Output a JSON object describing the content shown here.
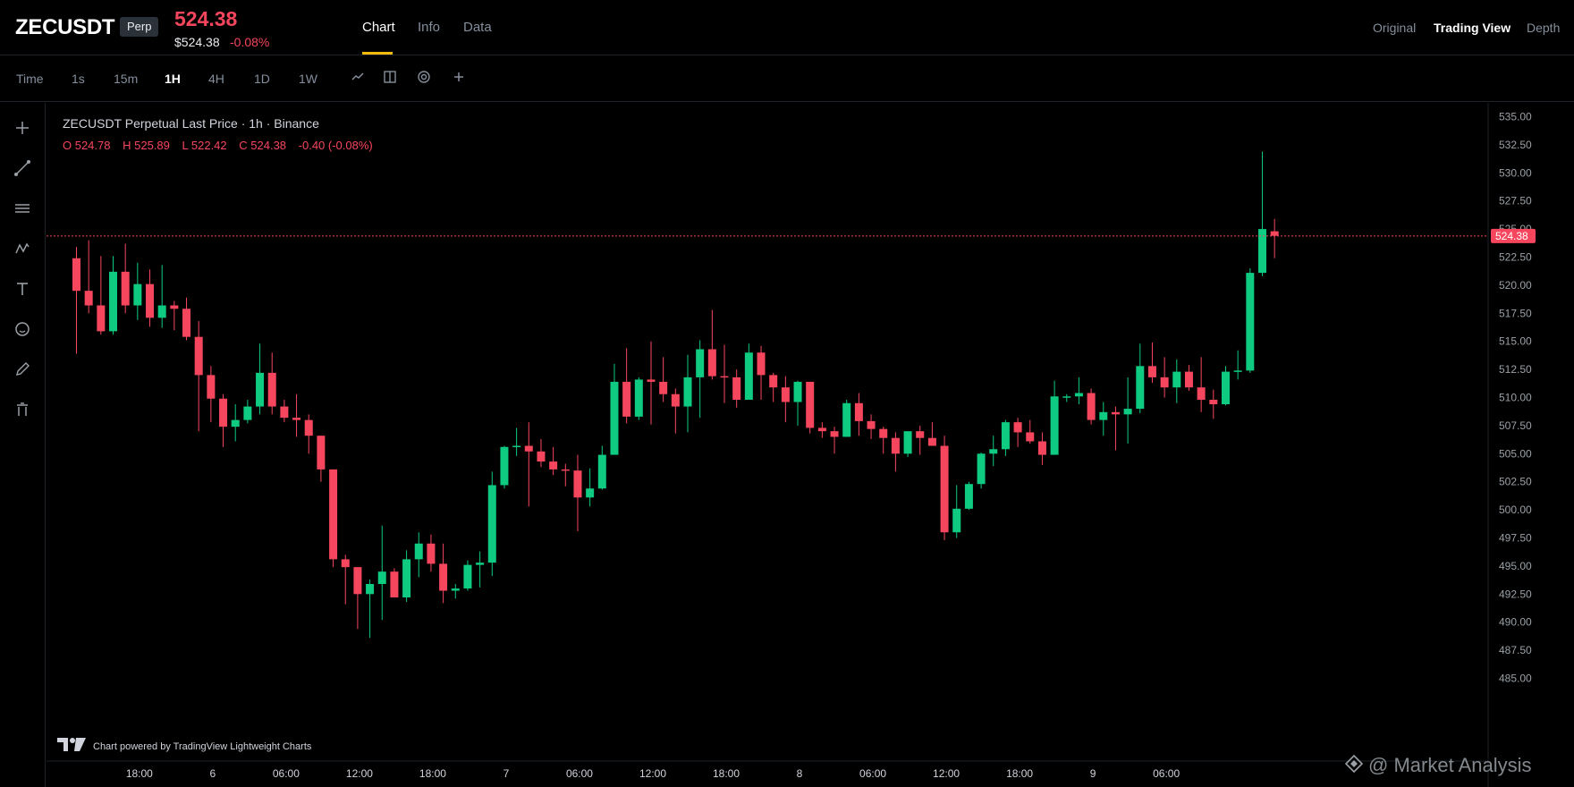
{
  "header": {
    "symbol": "ZECUSDT",
    "badge": "Perp",
    "last_price": "524.38",
    "sub_price": "$524.38",
    "sub_change": "-0.08%",
    "tabs": [
      {
        "label": "Chart",
        "active": true
      },
      {
        "label": "Info",
        "active": false
      },
      {
        "label": "Data",
        "active": false
      }
    ],
    "views": [
      {
        "label": "Original",
        "active": false
      },
      {
        "label": "Trading View",
        "active": true
      },
      {
        "label": "Depth",
        "active": false
      }
    ]
  },
  "toolbar": {
    "time_label": "Time",
    "intervals": [
      {
        "label": "1s",
        "active": false
      },
      {
        "label": "15m",
        "active": false
      },
      {
        "label": "1H",
        "active": true
      },
      {
        "label": "4H",
        "active": false
      },
      {
        "label": "1D",
        "active": false
      },
      {
        "label": "1W",
        "active": false
      }
    ],
    "icons": [
      "indicator-icon",
      "layout-icon",
      "settings-icon",
      "add-icon"
    ]
  },
  "left_tools": [
    "crosshair-icon",
    "trend-line-icon",
    "horizontal-lines-icon",
    "wave-icon",
    "text-icon",
    "emoji-icon",
    "pencil-icon",
    "trash-icon"
  ],
  "legend": {
    "title": "ZECUSDT Perpetual Last Price · 1h · Binance",
    "o": "O 524.78",
    "h": "H 525.89",
    "l": "L 522.42",
    "c": "C 524.38",
    "change": "-0.40 (-0.08%)"
  },
  "powered_by": "Chart powered by TradingView Lightweight Charts",
  "watermark": "@ Market Analysis",
  "colors": {
    "up": "#0ecb81",
    "down": "#f6465d",
    "accent": "#f0b90b",
    "background": "#000000"
  },
  "chart_data": {
    "type": "candlestick",
    "title": "ZECUSDT Perpetual Last Price · 1h · Binance",
    "last_price": 524.38,
    "last_price_label": "524.38",
    "ylim": [
      484,
      536
    ],
    "y_ticks": [
      "535.00",
      "532.50",
      "530.00",
      "527.50",
      "525.00",
      "522.50",
      "520.00",
      "517.50",
      "515.00",
      "512.50",
      "510.00",
      "507.50",
      "505.00",
      "502.50",
      "500.00",
      "497.50",
      "495.00",
      "492.50",
      "490.00",
      "487.50",
      "485.00"
    ],
    "x_ticks": [
      {
        "label": "18:00",
        "bar": 5
      },
      {
        "label": "6",
        "bar": 11
      },
      {
        "label": "06:00",
        "bar": 17
      },
      {
        "label": "12:00",
        "bar": 23
      },
      {
        "label": "18:00",
        "bar": 29
      },
      {
        "label": "7",
        "bar": 35
      },
      {
        "label": "06:00",
        "bar": 41
      },
      {
        "label": "12:00",
        "bar": 47
      },
      {
        "label": "18:00",
        "bar": 53
      },
      {
        "label": "8",
        "bar": 59
      },
      {
        "label": "06:00",
        "bar": 65
      },
      {
        "label": "12:00",
        "bar": 71
      },
      {
        "label": "18:00",
        "bar": 77
      },
      {
        "label": "9",
        "bar": 83
      },
      {
        "label": "06:00",
        "bar": 89
      }
    ],
    "candles": [
      {
        "o": 522.4,
        "h": 523.4,
        "l": 513.9,
        "c": 519.5
      },
      {
        "o": 519.5,
        "h": 524.0,
        "l": 517.5,
        "c": 518.2
      },
      {
        "o": 518.2,
        "h": 522.6,
        "l": 515.6,
        "c": 515.9
      },
      {
        "o": 515.9,
        "h": 522.6,
        "l": 515.6,
        "c": 521.2
      },
      {
        "o": 521.2,
        "h": 523.7,
        "l": 517.5,
        "c": 518.2
      },
      {
        "o": 518.2,
        "h": 522.0,
        "l": 516.9,
        "c": 520.1
      },
      {
        "o": 520.1,
        "h": 521.4,
        "l": 516.3,
        "c": 517.1
      },
      {
        "o": 517.1,
        "h": 521.8,
        "l": 516.2,
        "c": 518.2
      },
      {
        "o": 518.2,
        "h": 518.6,
        "l": 516.0,
        "c": 517.9
      },
      {
        "o": 517.9,
        "h": 518.9,
        "l": 515.1,
        "c": 515.4
      },
      {
        "o": 515.4,
        "h": 516.8,
        "l": 507.0,
        "c": 512.0
      },
      {
        "o": 512.0,
        "h": 512.8,
        "l": 507.8,
        "c": 509.9
      },
      {
        "o": 509.9,
        "h": 510.3,
        "l": 505.6,
        "c": 507.4
      },
      {
        "o": 507.4,
        "h": 509.4,
        "l": 506.1,
        "c": 508.0
      },
      {
        "o": 508.0,
        "h": 509.8,
        "l": 507.7,
        "c": 509.2
      },
      {
        "o": 509.2,
        "h": 514.8,
        "l": 508.5,
        "c": 512.2
      },
      {
        "o": 512.2,
        "h": 514.0,
        "l": 508.5,
        "c": 509.2
      },
      {
        "o": 509.2,
        "h": 509.8,
        "l": 507.8,
        "c": 508.2
      },
      {
        "o": 508.2,
        "h": 510.3,
        "l": 506.5,
        "c": 508.0
      },
      {
        "o": 508.0,
        "h": 508.5,
        "l": 505.0,
        "c": 506.6
      },
      {
        "o": 506.6,
        "h": 506.6,
        "l": 502.5,
        "c": 503.6
      },
      {
        "o": 503.6,
        "h": 503.6,
        "l": 494.9,
        "c": 495.6
      },
      {
        "o": 495.6,
        "h": 496.0,
        "l": 491.6,
        "c": 494.9
      },
      {
        "o": 494.9,
        "h": 494.9,
        "l": 489.4,
        "c": 492.5
      },
      {
        "o": 492.5,
        "h": 493.8,
        "l": 488.6,
        "c": 493.4
      },
      {
        "o": 493.4,
        "h": 498.6,
        "l": 490.2,
        "c": 494.5
      },
      {
        "o": 494.5,
        "h": 494.8,
        "l": 492.2,
        "c": 492.2
      },
      {
        "o": 492.2,
        "h": 496.4,
        "l": 491.8,
        "c": 495.6
      },
      {
        "o": 495.6,
        "h": 498.0,
        "l": 494.0,
        "c": 497.0
      },
      {
        "o": 497.0,
        "h": 497.8,
        "l": 494.5,
        "c": 495.2
      },
      {
        "o": 495.2,
        "h": 497.0,
        "l": 491.7,
        "c": 492.8
      },
      {
        "o": 492.8,
        "h": 493.4,
        "l": 492.1,
        "c": 493.0
      },
      {
        "o": 493.0,
        "h": 495.5,
        "l": 492.8,
        "c": 495.1
      },
      {
        "o": 495.1,
        "h": 496.3,
        "l": 493.1,
        "c": 495.3
      },
      {
        "o": 495.3,
        "h": 503.4,
        "l": 494.1,
        "c": 502.2
      },
      {
        "o": 502.2,
        "h": 505.7,
        "l": 501.9,
        "c": 505.6
      },
      {
        "o": 505.6,
        "h": 507.3,
        "l": 504.8,
        "c": 505.7
      },
      {
        "o": 505.7,
        "h": 507.8,
        "l": 500.3,
        "c": 505.2
      },
      {
        "o": 505.2,
        "h": 506.3,
        "l": 503.8,
        "c": 504.3
      },
      {
        "o": 504.3,
        "h": 505.6,
        "l": 503.1,
        "c": 503.6
      },
      {
        "o": 503.6,
        "h": 504.1,
        "l": 502.1,
        "c": 503.5
      },
      {
        "o": 503.5,
        "h": 504.9,
        "l": 498.1,
        "c": 501.1
      },
      {
        "o": 501.1,
        "h": 503.7,
        "l": 500.3,
        "c": 501.9
      },
      {
        "o": 501.9,
        "h": 505.7,
        "l": 501.8,
        "c": 504.9
      },
      {
        "o": 504.9,
        "h": 513.0,
        "l": 504.9,
        "c": 511.4
      },
      {
        "o": 511.4,
        "h": 514.4,
        "l": 507.7,
        "c": 508.3
      },
      {
        "o": 508.3,
        "h": 511.8,
        "l": 508.0,
        "c": 511.6
      },
      {
        "o": 511.6,
        "h": 515.0,
        "l": 507.6,
        "c": 511.4
      },
      {
        "o": 511.4,
        "h": 513.6,
        "l": 509.6,
        "c": 510.3
      },
      {
        "o": 510.3,
        "h": 510.8,
        "l": 506.8,
        "c": 509.2
      },
      {
        "o": 509.2,
        "h": 513.8,
        "l": 506.9,
        "c": 511.8
      },
      {
        "o": 511.8,
        "h": 515.1,
        "l": 508.2,
        "c": 514.3
      },
      {
        "o": 514.3,
        "h": 517.8,
        "l": 511.6,
        "c": 511.9
      },
      {
        "o": 511.9,
        "h": 514.7,
        "l": 509.5,
        "c": 511.8
      },
      {
        "o": 511.8,
        "h": 512.5,
        "l": 509.1,
        "c": 509.8
      },
      {
        "o": 509.8,
        "h": 514.8,
        "l": 509.8,
        "c": 514.0
      },
      {
        "o": 514.0,
        "h": 514.6,
        "l": 509.8,
        "c": 512.0
      },
      {
        "o": 512.0,
        "h": 512.2,
        "l": 509.6,
        "c": 510.9
      },
      {
        "o": 510.9,
        "h": 511.9,
        "l": 507.8,
        "c": 509.6
      },
      {
        "o": 509.6,
        "h": 511.5,
        "l": 507.5,
        "c": 511.4
      },
      {
        "o": 511.4,
        "h": 511.4,
        "l": 506.8,
        "c": 507.3
      },
      {
        "o": 507.3,
        "h": 507.8,
        "l": 506.4,
        "c": 507.0
      },
      {
        "o": 507.0,
        "h": 507.4,
        "l": 505.0,
        "c": 506.5
      },
      {
        "o": 506.5,
        "h": 509.8,
        "l": 506.5,
        "c": 509.5
      },
      {
        "o": 509.5,
        "h": 510.4,
        "l": 506.6,
        "c": 507.9
      },
      {
        "o": 507.9,
        "h": 508.5,
        "l": 506.3,
        "c": 507.2
      },
      {
        "o": 507.2,
        "h": 507.4,
        "l": 505.0,
        "c": 506.4
      },
      {
        "o": 506.4,
        "h": 506.9,
        "l": 503.4,
        "c": 505.0
      },
      {
        "o": 505.0,
        "h": 507.0,
        "l": 504.7,
        "c": 507.0
      },
      {
        "o": 507.0,
        "h": 507.5,
        "l": 504.9,
        "c": 506.4
      },
      {
        "o": 506.4,
        "h": 507.8,
        "l": 505.7,
        "c": 505.7
      },
      {
        "o": 505.7,
        "h": 506.6,
        "l": 497.3,
        "c": 498.0
      },
      {
        "o": 498.0,
        "h": 502.2,
        "l": 497.5,
        "c": 500.1
      },
      {
        "o": 500.1,
        "h": 502.5,
        "l": 500.0,
        "c": 502.3
      },
      {
        "o": 502.3,
        "h": 505.1,
        "l": 501.9,
        "c": 505.0
      },
      {
        "o": 505.0,
        "h": 506.6,
        "l": 503.9,
        "c": 505.4
      },
      {
        "o": 505.4,
        "h": 508.0,
        "l": 504.8,
        "c": 507.8
      },
      {
        "o": 507.8,
        "h": 508.2,
        "l": 505.6,
        "c": 506.9
      },
      {
        "o": 506.9,
        "h": 508.0,
        "l": 505.9,
        "c": 506.1
      },
      {
        "o": 506.1,
        "h": 506.9,
        "l": 504.0,
        "c": 504.9
      },
      {
        "o": 504.9,
        "h": 511.5,
        "l": 504.9,
        "c": 510.1
      },
      {
        "o": 510.1,
        "h": 510.3,
        "l": 509.6,
        "c": 510.1
      },
      {
        "o": 510.1,
        "h": 511.8,
        "l": 509.4,
        "c": 510.4
      },
      {
        "o": 510.4,
        "h": 510.8,
        "l": 507.6,
        "c": 508.0
      },
      {
        "o": 508.0,
        "h": 509.6,
        "l": 506.6,
        "c": 508.7
      },
      {
        "o": 508.7,
        "h": 509.2,
        "l": 505.3,
        "c": 508.5
      },
      {
        "o": 508.5,
        "h": 511.8,
        "l": 505.9,
        "c": 509.0
      },
      {
        "o": 509.0,
        "h": 514.8,
        "l": 508.6,
        "c": 512.8
      },
      {
        "o": 512.8,
        "h": 514.9,
        "l": 511.3,
        "c": 511.8
      },
      {
        "o": 511.8,
        "h": 513.6,
        "l": 510.0,
        "c": 510.9
      },
      {
        "o": 510.9,
        "h": 513.4,
        "l": 509.5,
        "c": 512.3
      },
      {
        "o": 512.3,
        "h": 512.9,
        "l": 510.6,
        "c": 510.9
      },
      {
        "o": 510.9,
        "h": 513.6,
        "l": 508.7,
        "c": 509.8
      },
      {
        "o": 509.8,
        "h": 510.7,
        "l": 508.1,
        "c": 509.4
      },
      {
        "o": 509.4,
        "h": 512.8,
        "l": 509.3,
        "c": 512.3
      },
      {
        "o": 512.3,
        "h": 514.2,
        "l": 511.6,
        "c": 512.4
      },
      {
        "o": 512.4,
        "h": 521.5,
        "l": 512.2,
        "c": 521.1
      },
      {
        "o": 521.1,
        "h": 531.9,
        "l": 520.8,
        "c": 525.0
      },
      {
        "o": 524.8,
        "h": 525.9,
        "l": 522.4,
        "c": 524.4
      }
    ]
  }
}
